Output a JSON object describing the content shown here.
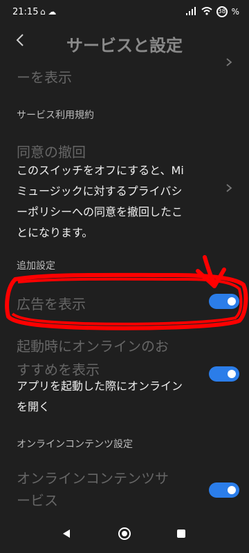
{
  "status_bar": {
    "time": "21:15",
    "icons_left": "⌂ ☁",
    "battery_percent": "38",
    "battery_suffix": "%"
  },
  "header": {
    "title": "サービスと設定",
    "back_icon": "chevron-left-icon"
  },
  "items": {
    "display_item": {
      "title": "ーを表示"
    },
    "terms_label": "サービス利用規約",
    "withdraw": {
      "title": "同意の撤回",
      "desc_lines": [
        "このスイッチをオフにすると、Mi",
        "ミュージックに対するプライバシ",
        "ーポリシーへの同意を撤回したこ",
        "とになります。"
      ]
    },
    "additional_label": "追加設定",
    "show_ads": {
      "title": "広告を表示",
      "on": true
    },
    "startup": {
      "title_lines": [
        "起動時にオンラインのお",
        "すすめを表示"
      ],
      "desc_lines": [
        "アプリを起動した際にオンライン",
        "を開く"
      ],
      "on": true
    },
    "online_label": "オンラインコンテンツ設定",
    "online_service": {
      "title_lines": [
        "オンラインコンテンツサ",
        "ービス"
      ],
      "on": true
    }
  },
  "annotation": {
    "color": "#ff0000"
  },
  "nav_bar": {
    "back": "◀",
    "home": "◉",
    "recents": "■"
  },
  "colors": {
    "accent": "#2b7de9",
    "background": "#1f1f1f"
  }
}
